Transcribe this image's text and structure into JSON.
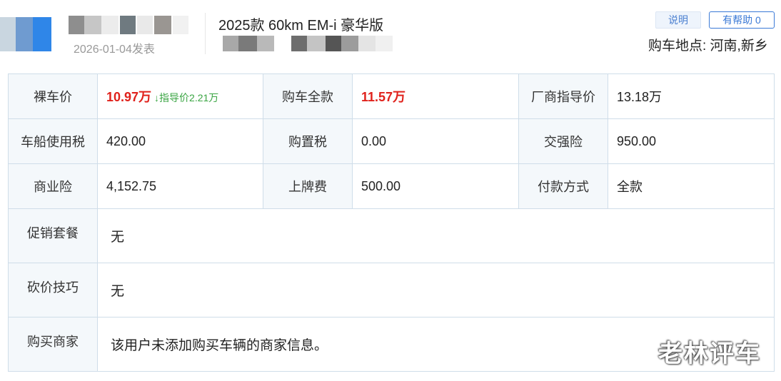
{
  "user": {
    "post_date": "2026-01-04发表"
  },
  "car": {
    "model": "2025款 60km EM-i 豪华版"
  },
  "actions": {
    "explain_label": "说明",
    "helpful_label": "有帮助 0"
  },
  "location": "购车地点: 河南,新乡",
  "prices": {
    "bare_price_label": "裸车价",
    "bare_price": "10.97万",
    "guide_drop": "↓指导价2.21万",
    "total_label": "购车全款",
    "total": "11.57万",
    "msrp_label": "厂商指导价",
    "msrp": "13.18万",
    "vessel_tax_label": "车船使用税",
    "vessel_tax": "420.00",
    "purchase_tax_label": "购置税",
    "purchase_tax": "0.00",
    "compulsory_ins_label": "交强险",
    "compulsory_ins": "950.00",
    "commercial_ins_label": "商业险",
    "commercial_ins": "4,152.75",
    "plate_fee_label": "上牌费",
    "plate_fee": "500.00",
    "payment_label": "付款方式",
    "payment": "全款"
  },
  "details": {
    "promo_label": "促销套餐",
    "promo": "无",
    "bargain_label": "砍价技巧",
    "bargain": "无",
    "dealer_label": "购买商家",
    "dealer": "该用户未添加购买车辆的商家信息。"
  },
  "watermark": "老林评车",
  "colors": {
    "accent_blue": "#3a79d6",
    "price_red": "#e0221c",
    "drop_green": "#3aa543",
    "label_bg": "#f4f8fb",
    "border": "#cfdde9"
  }
}
